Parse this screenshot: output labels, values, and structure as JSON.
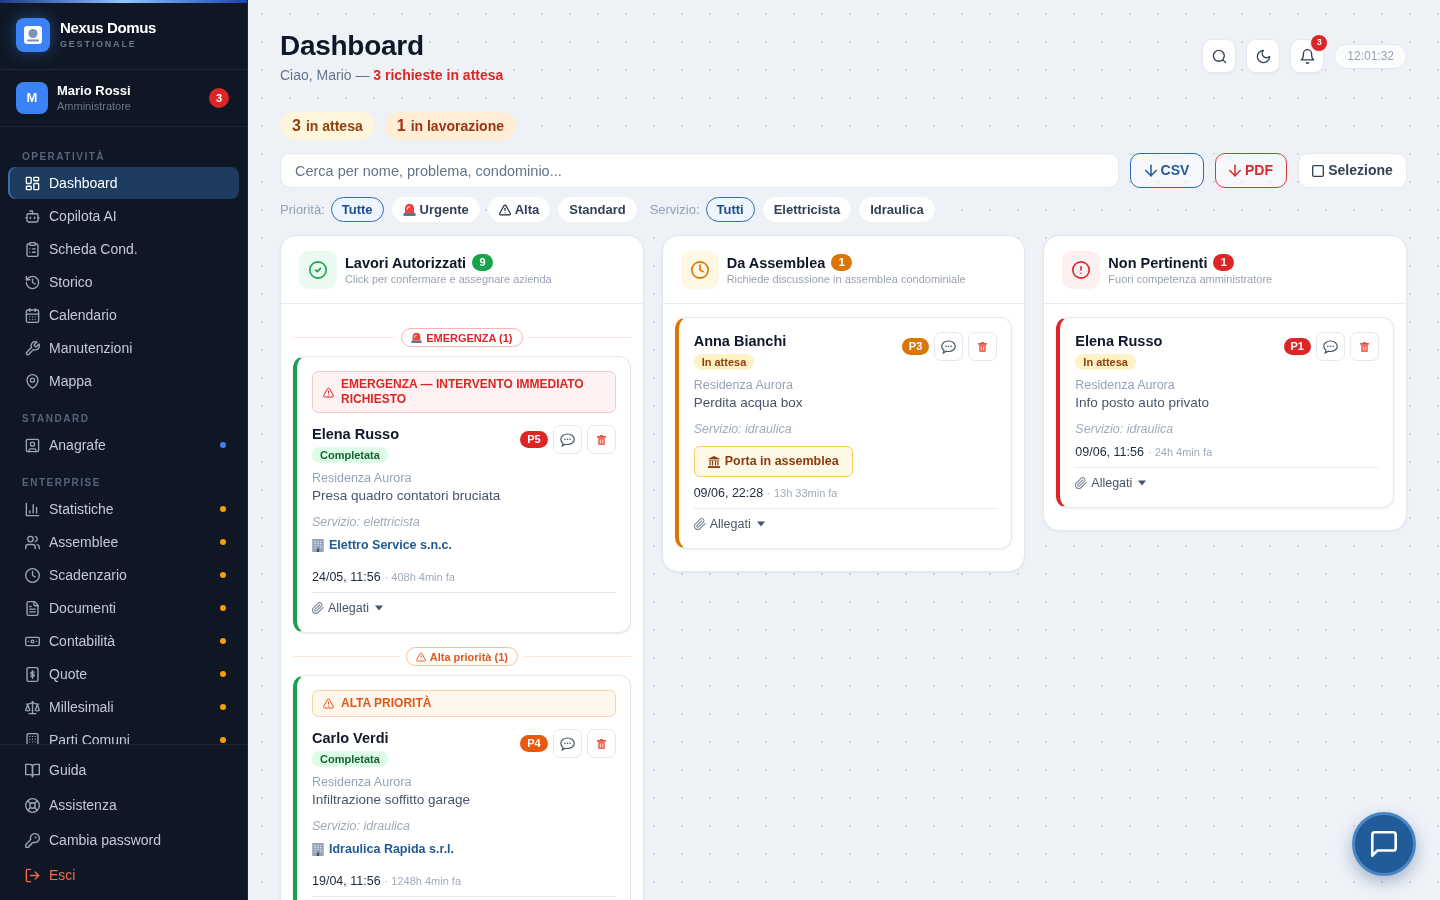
{
  "sidebar": {
    "brand": {
      "name": "Nexus Domus",
      "tagline": "GESTIONALE"
    },
    "user": {
      "initial": "M",
      "name": "Mario Rossi",
      "role": "Amministratore",
      "badge": "3"
    },
    "sections": [
      {
        "title": "OPERATIVITÀ",
        "items": [
          {
            "label": "Dashboard",
            "selected": true
          },
          {
            "label": "Copilota AI",
            "selected": false
          },
          {
            "label": "Scheda Cond.",
            "selected": false
          },
          {
            "label": "Storico",
            "selected": false
          },
          {
            "label": "Calendario",
            "selected": false
          },
          {
            "label": "Manutenzioni",
            "selected": false
          },
          {
            "label": "Mappa",
            "selected": false
          }
        ]
      },
      {
        "title": "STANDARD",
        "items": [
          {
            "label": "Anagrafe",
            "selected": false,
            "color": "#3b82f6"
          }
        ]
      },
      {
        "title": "ENTERPRISE",
        "items": [
          {
            "label": "Statistiche",
            "selected": false,
            "color": "#f59e0b"
          },
          {
            "label": "Assemblee",
            "selected": false,
            "color": "#f59e0b"
          },
          {
            "label": "Scadenzario",
            "selected": false,
            "color": "#f59e0b"
          },
          {
            "label": "Documenti",
            "selected": false,
            "color": "#f59e0b"
          },
          {
            "label": "Contabilità",
            "selected": false,
            "color": "#f59e0b"
          },
          {
            "label": "Quote",
            "selected": false,
            "color": "#f59e0b"
          },
          {
            "label": "Millesimali",
            "selected": false,
            "color": "#f59e0b"
          },
          {
            "label": "Parti Comuni",
            "selected": false,
            "color": "#f59e0b"
          }
        ]
      }
    ],
    "footer_items": [
      {
        "label": "Guida",
        "kind": "link"
      },
      {
        "label": "Assistenza",
        "kind": "link"
      },
      {
        "label": "Cambia password",
        "kind": "link"
      },
      {
        "label": "Esci",
        "kind": "logout"
      }
    ]
  },
  "header": {
    "title": "Dashboard",
    "subtitle": "Ciao, Mario — **3 richieste in attesa**",
    "notifications_badge": "3",
    "clock": "12:01:32"
  },
  "stats": [
    {
      "count": "3",
      "label": "in attesa",
      "kind": "waiting"
    },
    {
      "count": "1",
      "label": "in lavorazione",
      "kind": "in_progress"
    }
  ],
  "search": {
    "placeholder": "Cerca per nome, problema, condominio..."
  },
  "actions": [
    {
      "label": "CSV",
      "kind": "csv"
    },
    {
      "label": "PDF",
      "kind": "pdf"
    },
    {
      "label": "Selezione",
      "kind": "select"
    }
  ],
  "filters": [
    {
      "label": "Priorità:",
      "chips": [
        {
          "label": "Tutte",
          "kind": "plain",
          "selected": true
        },
        {
          "label": "Urgente",
          "kind": "urgent",
          "selected": false
        },
        {
          "label": "Alta",
          "kind": "high",
          "selected": false
        },
        {
          "label": "Standard",
          "kind": "plain",
          "selected": false
        }
      ]
    },
    {
      "label": "Servizio:",
      "chips": [
        {
          "label": "Tutti",
          "kind": "plain",
          "selected": true
        },
        {
          "label": "Elettricista",
          "kind": "plain",
          "selected": false
        },
        {
          "label": "Idraulica",
          "kind": "plain",
          "selected": false
        }
      ]
    }
  ],
  "columns": [
    {
      "kind": "authorized",
      "title": "Lavori Autorizzati",
      "count": "9",
      "subtitle": "Click per confermare e assegnare azienda",
      "groups": [
        {
          "kind": "emergency",
          "label": "EMERGENZA (1)",
          "cards": [
            {
              "alert": {
                "kind": "emergency",
                "text": "EMERGENZA — INTERVENTO IMMEDIATO RICHIESTO"
              },
              "name": "Elena Russo",
              "status": {
                "label": "Completata",
                "kind": "done"
              },
              "priority": {
                "label": "P5",
                "color": "#dc2626"
              },
              "building": "Residenza Aurora",
              "problem": "Presa quadro contatori bruciata",
              "service": "Servizio: elettricista",
              "company": "Elettro Service s.n.c.",
              "date": "24/05, 11:56",
              "ago": "· 408h 4min fa",
              "attachments": "Allegati"
            }
          ]
        },
        {
          "kind": "high",
          "label": "Alta priorità (1)",
          "cards": [
            {
              "alert": {
                "kind": "high",
                "text": "ALTA PRIORITÀ"
              },
              "name": "Carlo Verdi",
              "status": {
                "label": "Completata",
                "kind": "done"
              },
              "priority": {
                "label": "P4",
                "color": "#ea580c"
              },
              "building": "Residenza Aurora",
              "problem": "Infiltrazione soffitto garage",
              "service": "Servizio: idraulica",
              "company": "Idraulica Rapida s.r.l.",
              "date": "19/04, 11:56",
              "ago": "· 1248h 4min fa"
            }
          ]
        }
      ]
    },
    {
      "kind": "assembly",
      "title": "Da Assemblea",
      "count": "1",
      "subtitle": "Richiede discussione in assemblea condominiale",
      "groups": [
        {
          "cards": [
            {
              "name": "Anna Bianchi",
              "status": {
                "label": "In attesa",
                "kind": "waiting"
              },
              "priority": {
                "label": "P3",
                "color": "#d97706"
              },
              "building": "Residenza Aurora",
              "problem": "Perdita acqua box",
              "service": "Servizio: idraulica",
              "action": "Porta in assemblea",
              "date": "09/06, 22:28",
              "ago": "· 13h 33min fa",
              "attachments": "Allegati"
            }
          ]
        }
      ]
    },
    {
      "kind": "rejected",
      "title": "Non Pertinenti",
      "count": "1",
      "subtitle": "Fuori competenza amministratore",
      "groups": [
        {
          "cards": [
            {
              "name": "Elena Russo",
              "status": {
                "label": "In attesa",
                "kind": "waiting"
              },
              "priority": {
                "label": "P1",
                "color": "#dc2626"
              },
              "building": "Residenza Aurora",
              "problem": "Info posto auto privato",
              "service": "Servizio: idraulica",
              "date": "09/06, 11:56",
              "ago": "· 24h 4min fa",
              "attachments": "Allegati"
            }
          ]
        }
      ]
    }
  ]
}
